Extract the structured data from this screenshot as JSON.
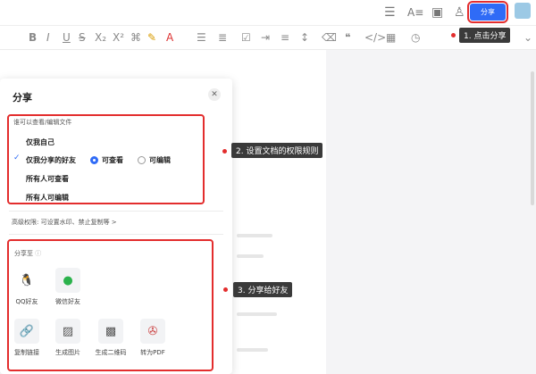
{
  "header": {
    "share_label": "分享",
    "icons": [
      "list-icon",
      "text-format-icon",
      "present-icon",
      "add-user-icon"
    ]
  },
  "toolbar": {
    "icons": [
      "bold-icon",
      "italic-icon",
      "underline-icon",
      "strike-icon",
      "subscript-icon",
      "format-brush-icon",
      "highlight-icon",
      "font-color-icon",
      "list-icon",
      "ordered-list-icon",
      "checklist-icon",
      "quote-icon",
      "code-icon",
      "clock-icon",
      "chevron-down-icon"
    ]
  },
  "panel": {
    "title": "分享",
    "permission_heading": "谁可以查看/编辑文件",
    "options": [
      "仅我自己",
      "仅我分享的好友",
      "所有人可查看",
      "所有人可编辑"
    ],
    "selected_option": "仅我分享的好友",
    "sub_options": [
      "可查看",
      "可编辑"
    ],
    "selected_sub_option": "可查看",
    "advanced": "高级权限: 可设置水印、禁止复制等 >",
    "share_to": "分享至",
    "share_targets": [
      {
        "label": "QQ好友",
        "icon": "qq-icon"
      },
      {
        "label": "微信好友",
        "icon": "wechat-icon"
      }
    ],
    "share_actions": [
      {
        "label": "复制链接",
        "icon": "link-icon"
      },
      {
        "label": "生成图片",
        "icon": "image-icon"
      },
      {
        "label": "生成二维码",
        "icon": "qrcode-icon"
      },
      {
        "label": "转为PDF",
        "icon": "pdf-icon"
      }
    ]
  },
  "callouts": [
    "1. 点击分享",
    "2. 设置文档的权限规则",
    "3. 分享给好友"
  ],
  "colors": {
    "accent": "#2f6bf6",
    "annotation": "#e32d2d",
    "callout_bg": "#3a3a3a"
  }
}
